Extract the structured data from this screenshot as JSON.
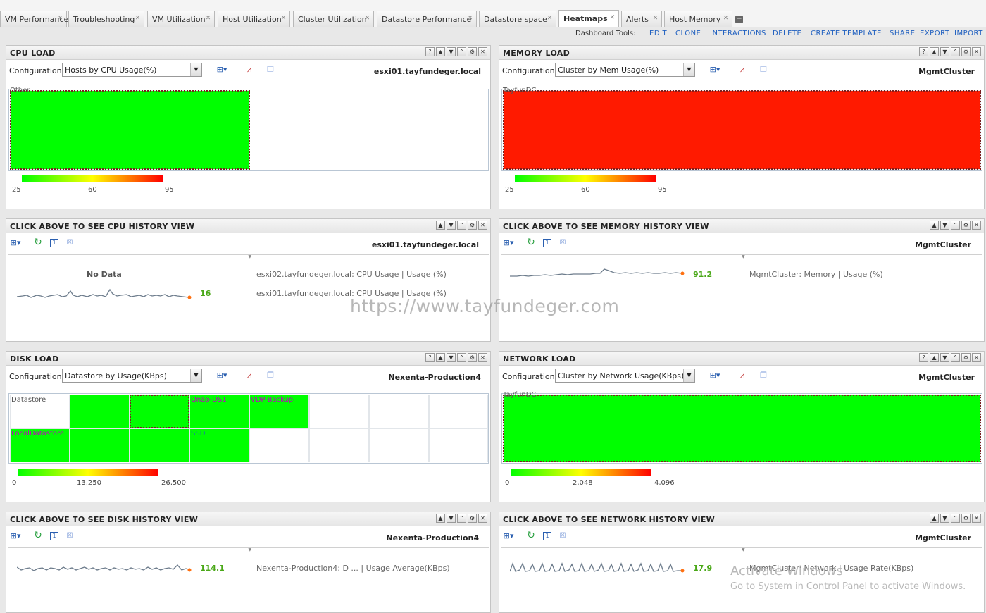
{
  "tabs": [
    {
      "label": "VM Performance"
    },
    {
      "label": "Troubleshooting"
    },
    {
      "label": "VM Utilization"
    },
    {
      "label": "Host Utilization"
    },
    {
      "label": "Cluster Utilization"
    },
    {
      "label": "Datastore Performance"
    },
    {
      "label": "Datastore space"
    },
    {
      "label": "Heatmaps"
    },
    {
      "label": "Alerts"
    },
    {
      "label": "Host Memory"
    }
  ],
  "tools": {
    "label": "Dashboard Tools:",
    "links": [
      "EDIT",
      "CLONE",
      "INTERACTIONS",
      "DELETE",
      "CREATE TEMPLATE",
      "SHARE",
      "EXPORT",
      "IMPORT"
    ]
  },
  "config_label": "Configuration:",
  "cpu": {
    "title": "CPU LOAD",
    "config": "Hosts by CPU Usage(%)",
    "entity": "esxi01.tayfundeger.local",
    "group_label": "Other",
    "legend": [
      "25",
      "60",
      "95"
    ]
  },
  "memory": {
    "title": "MEMORY LOAD",
    "config": "Cluster by Mem Usage(%)",
    "entity": "MgmtCluster",
    "group_label": "TayfunDC",
    "legend": [
      "25",
      "60",
      "95"
    ]
  },
  "cpu_hist": {
    "title": "CLICK ABOVE TO SEE CPU HISTORY VIEW",
    "entity": "esxi01.tayfundeger.local",
    "nodata": "No Data",
    "rows": [
      {
        "metric": "esxi02.tayfundeger.local: CPU Usage | Usage (%)"
      },
      {
        "value": "16",
        "metric": "esxi01.tayfundeger.local: CPU Usage | Usage (%)"
      }
    ]
  },
  "mem_hist": {
    "title": "CLICK ABOVE TO SEE MEMORY HISTORY VIEW",
    "entity": "MgmtCluster",
    "value": "91.2",
    "metric": "MgmtCluster: Memory | Usage (%)"
  },
  "disk": {
    "title": "DISK LOAD",
    "config": "Datastore by Usage(KBps)",
    "entity": "Nexenta-Production4",
    "labels": {
      "datastore": "Datastore",
      "qnap": "Qnap-DS1",
      "vdp": "VDP-Backup",
      "local": "LocalDatastore",
      "ssd": "SSD"
    },
    "legend": [
      "0",
      "13,250",
      "26,500"
    ]
  },
  "network": {
    "title": "NETWORK LOAD",
    "config": "Cluster by Network Usage(KBps)",
    "entity": "MgmtCluster",
    "group_label": "TayfunDC",
    "legend": [
      "0",
      "2,048",
      "4,096"
    ]
  },
  "disk_hist": {
    "title": "CLICK ABOVE TO SEE DISK HISTORY VIEW",
    "entity": "Nexenta-Production4",
    "value": "114.1",
    "metric": "Nexenta-Production4: D ... | Usage Average(KBps)"
  },
  "net_hist": {
    "title": "CLICK ABOVE TO SEE NETWORK HISTORY VIEW",
    "entity": "MgmtCluster",
    "value": "17.9",
    "metric": "MgmtCluster: Network | Usage Rate(KBps)"
  },
  "overlay": {
    "watermark": "https://www.tayfundeger.com",
    "activate_title": "Activate Windows",
    "activate_sub": "Go to System in Control Panel to activate Windows."
  },
  "colors": {
    "hot": "#ff1a00",
    "cool": "#00ff00",
    "link": "#2060c0",
    "value": "#4aa818"
  }
}
